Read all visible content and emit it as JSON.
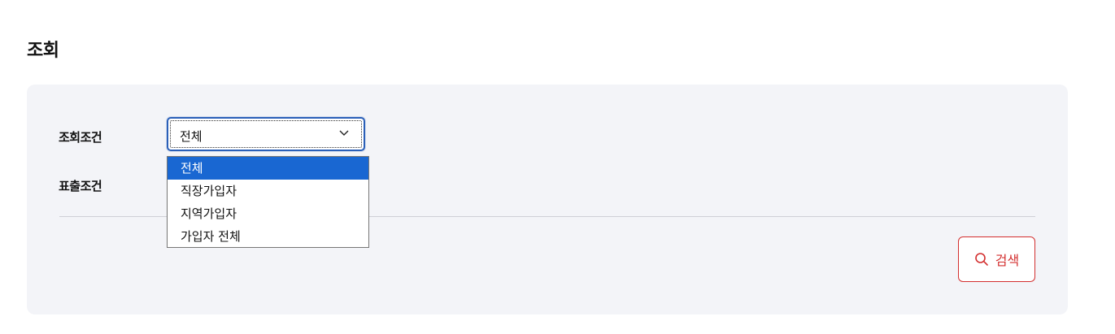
{
  "page": {
    "title": "조회"
  },
  "filters": {
    "condition_label": "조회조건",
    "display_label": "표출조건",
    "condition_select": {
      "value": "전체",
      "options": [
        "전체",
        "직장가입자",
        "지역가입자",
        "가입자 전체"
      ],
      "selected_index": 0
    }
  },
  "actions": {
    "search_label": "검색",
    "search_icon": "search-icon"
  },
  "colors": {
    "accent_blue": "#1967d2",
    "focus_border": "#2a5fb8",
    "search_red": "#d32f2f",
    "panel_bg": "#f3f4f8"
  }
}
